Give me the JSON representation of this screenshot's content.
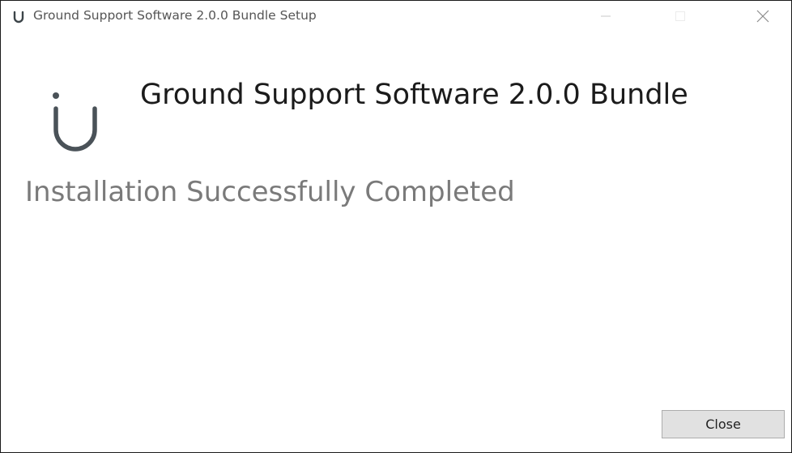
{
  "window": {
    "title": "Ground Support Software 2.0.0 Bundle Setup",
    "controls": {
      "minimize": "minimize-icon",
      "maximize": "maximize-icon",
      "close": "close-icon"
    }
  },
  "main": {
    "heading": "Ground Support Software 2.0.0 Bundle",
    "status": "Installation Successfully Completed",
    "logo_icon": "u-logo-icon"
  },
  "footer": {
    "close_label": "Close"
  },
  "colors": {
    "logo": "#4a5258",
    "status_text": "#7a7a7a",
    "button_bg": "#e1e1e1"
  }
}
